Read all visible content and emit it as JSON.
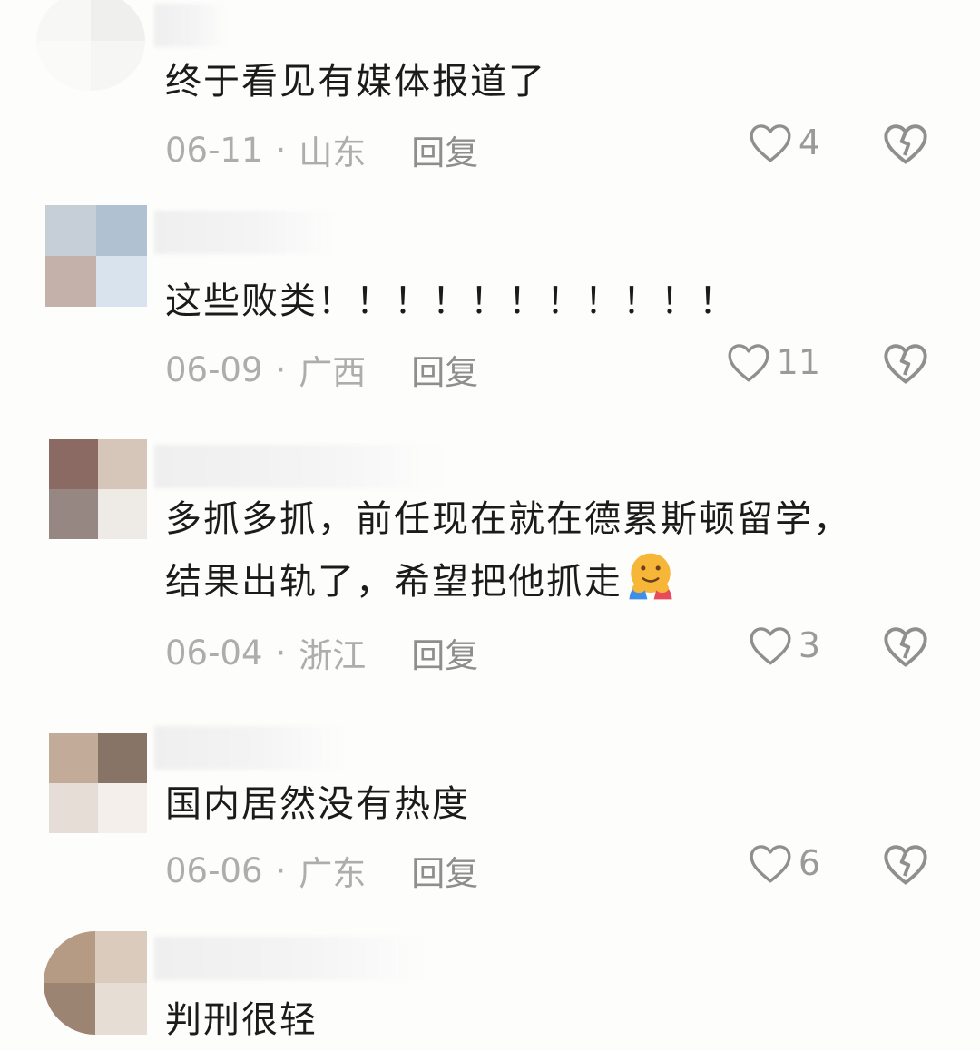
{
  "comments": [
    {
      "text": "终于看见有媒体报道了",
      "date": "06-11",
      "region": "山东",
      "reply_label": "回复",
      "likes": "4",
      "avatar_colors": [
        "#f7f7f5",
        "#efefed",
        "#fafaf8",
        "#f6f6f4"
      ]
    },
    {
      "text": "这些败类！！！！！！！！！！！",
      "date": "06-09",
      "region": "广西",
      "reply_label": "回复",
      "likes": "11",
      "avatar_colors": [
        "#c6cfd8",
        "#b0c1d2",
        "#c4b2aa",
        "#d9e3ee"
      ]
    },
    {
      "text": "多抓多抓，前任现在就在德累斯顿留学，\n结果出轨了，希望把他抓走",
      "date": "06-04",
      "region": "浙江",
      "reply_label": "回复",
      "likes": "3",
      "emoji": "hugging-face-emoji",
      "avatar_colors": [
        "#8a6a62",
        "#d6c5b9",
        "#978783",
        "#eeeae6"
      ]
    },
    {
      "text": "国内居然没有热度",
      "date": "06-06",
      "region": "广东",
      "reply_label": "回复",
      "likes": "6",
      "avatar_colors": [
        "#c2ab98",
        "#877466",
        "#e6ddd6",
        "#f4efea"
      ]
    },
    {
      "text": "判刑很轻",
      "date": "",
      "region": "",
      "reply_label": "",
      "likes": "",
      "avatar_colors": [
        "#b59b84",
        "#dbcbbd",
        "#9c8472",
        "#e6ddd4"
      ]
    }
  ],
  "icons": {
    "like": "heart-outline-icon",
    "dislike": "broken-heart-icon"
  },
  "colors": {
    "text": "#1b1b1b",
    "meta": "#adadad",
    "reply": "#8e8e8e",
    "icon": "#8f8f8f"
  }
}
